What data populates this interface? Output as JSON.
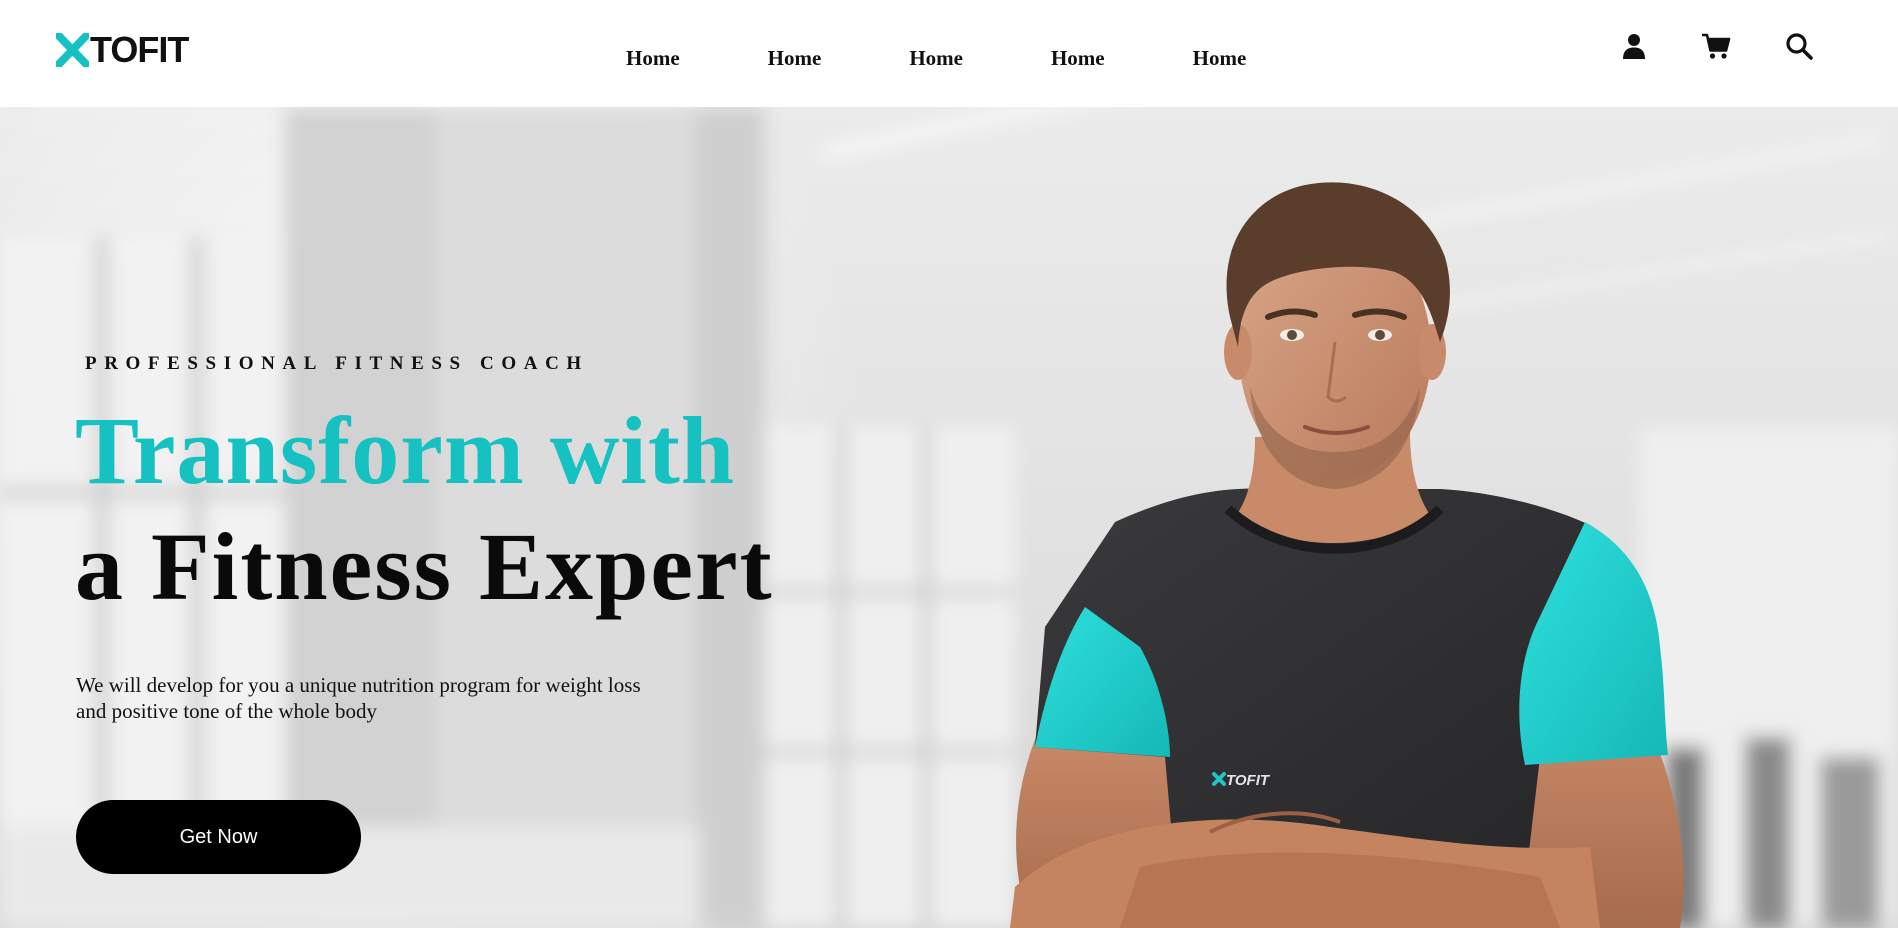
{
  "header": {
    "logo_text": "TOFIT",
    "nav": [
      "Home",
      "Home",
      "Home",
      "Home",
      "Home"
    ],
    "icons": [
      "user-icon",
      "cart-icon",
      "search-icon"
    ]
  },
  "hero": {
    "eyebrow": "PROFESSIONAL FITNESS COACH",
    "headline_line1": "Transform with",
    "headline_line2": "a Fitness Expert",
    "description": "We will develop for you a unique nutrition program for weight loss and positive tone of the whole body",
    "cta_label": "Get Now",
    "shirt_logo": "TOFIT"
  },
  "colors": {
    "accent": "#15c1c1",
    "text": "#111111",
    "button_bg": "#000000",
    "button_text": "#ffffff",
    "shirt": "#2f2f31"
  }
}
